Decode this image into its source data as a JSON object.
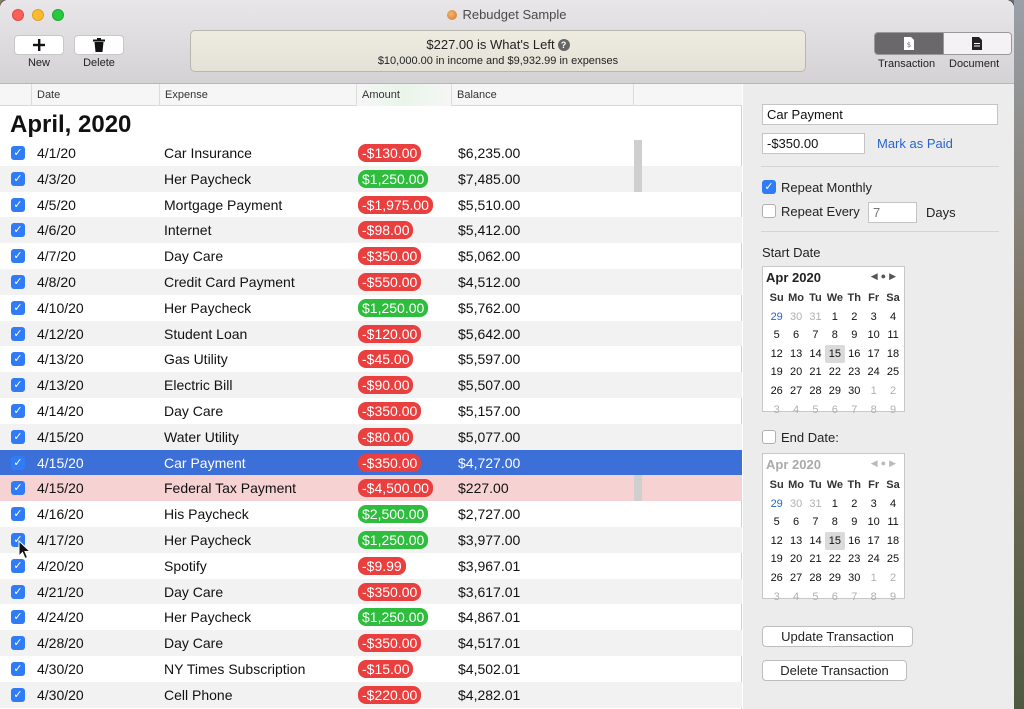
{
  "window": {
    "title": "Rebudget Sample"
  },
  "toolbar": {
    "new_label": "New",
    "delete_label": "Delete",
    "summary_line1": "$227.00 is What's Left",
    "summary_line2": "$10,000.00 in income and $9,932.99 in expenses",
    "transaction_label": "Transaction",
    "document_label": "Document"
  },
  "table": {
    "columns": [
      "Date",
      "Expense",
      "Amount",
      "Balance"
    ],
    "month": "April, 2020",
    "rows": [
      {
        "date": "4/1/20",
        "expense": "Car Insurance",
        "amount": "-$130.00",
        "balance": "$6,235.00",
        "kind": "neg"
      },
      {
        "date": "4/3/20",
        "expense": "Her Paycheck",
        "amount": "$1,250.00",
        "balance": "$7,485.00",
        "kind": "pos"
      },
      {
        "date": "4/5/20",
        "expense": "Mortgage Payment",
        "amount": "-$1,975.00",
        "balance": "$5,510.00",
        "kind": "neg"
      },
      {
        "date": "4/6/20",
        "expense": "Internet",
        "amount": "-$98.00",
        "balance": "$5,412.00",
        "kind": "neg"
      },
      {
        "date": "4/7/20",
        "expense": "Day Care",
        "amount": "-$350.00",
        "balance": "$5,062.00",
        "kind": "neg"
      },
      {
        "date": "4/8/20",
        "expense": "Credit Card Payment",
        "amount": "-$550.00",
        "balance": "$4,512.00",
        "kind": "neg"
      },
      {
        "date": "4/10/20",
        "expense": "Her Paycheck",
        "amount": "$1,250.00",
        "balance": "$5,762.00",
        "kind": "pos"
      },
      {
        "date": "4/12/20",
        "expense": "Student Loan",
        "amount": "-$120.00",
        "balance": "$5,642.00",
        "kind": "neg"
      },
      {
        "date": "4/13/20",
        "expense": "Gas Utility",
        "amount": "-$45.00",
        "balance": "$5,597.00",
        "kind": "neg"
      },
      {
        "date": "4/13/20",
        "expense": "Electric Bill",
        "amount": "-$90.00",
        "balance": "$5,507.00",
        "kind": "neg"
      },
      {
        "date": "4/14/20",
        "expense": "Day Care",
        "amount": "-$350.00",
        "balance": "$5,157.00",
        "kind": "neg"
      },
      {
        "date": "4/15/20",
        "expense": "Water Utility",
        "amount": "-$80.00",
        "balance": "$5,077.00",
        "kind": "neg"
      },
      {
        "date": "4/15/20",
        "expense": "Car Payment",
        "amount": "-$350.00",
        "balance": "$4,727.00",
        "kind": "neg"
      },
      {
        "date": "4/15/20",
        "expense": "Federal Tax Payment",
        "amount": "-$4,500.00",
        "balance": "$227.00",
        "kind": "neg"
      },
      {
        "date": "4/16/20",
        "expense": "His Paycheck",
        "amount": "$2,500.00",
        "balance": "$2,727.00",
        "kind": "pos"
      },
      {
        "date": "4/17/20",
        "expense": "Her Paycheck",
        "amount": "$1,250.00",
        "balance": "$3,977.00",
        "kind": "pos"
      },
      {
        "date": "4/20/20",
        "expense": "Spotify",
        "amount": "-$9.99",
        "balance": "$3,967.01",
        "kind": "neg"
      },
      {
        "date": "4/21/20",
        "expense": "Day Care",
        "amount": "-$350.00",
        "balance": "$3,617.01",
        "kind": "neg"
      },
      {
        "date": "4/24/20",
        "expense": "Her Paycheck",
        "amount": "$1,250.00",
        "balance": "$4,867.01",
        "kind": "pos"
      },
      {
        "date": "4/28/20",
        "expense": "Day Care",
        "amount": "-$350.00",
        "balance": "$4,517.01",
        "kind": "neg"
      },
      {
        "date": "4/30/20",
        "expense": "NY Times Subscription",
        "amount": "-$15.00",
        "balance": "$4,502.01",
        "kind": "neg"
      },
      {
        "date": "4/30/20",
        "expense": "Cell Phone",
        "amount": "-$220.00",
        "balance": "$4,282.01",
        "kind": "neg"
      }
    ]
  },
  "detail": {
    "name_value": "Car Payment",
    "amount_value": "-$350.00",
    "mark_paid_label": "Mark as Paid",
    "repeat_monthly_label": "Repeat Monthly",
    "repeat_every_label": "Repeat Every",
    "repeat_every_placeholder": "7",
    "days_label": "Days",
    "start_date_label": "Start Date",
    "end_date_label": "End Date:",
    "update_label": "Update Transaction",
    "delete_label": "Delete Transaction"
  },
  "calendar": {
    "month_label": "Apr 2020",
    "weekdays": [
      "Su",
      "Mo",
      "Tu",
      "We",
      "Th",
      "Fr",
      "Sa"
    ],
    "weeks": [
      [
        "29",
        "30",
        "31",
        "1",
        "2",
        "3",
        "4"
      ],
      [
        "5",
        "6",
        "7",
        "8",
        "9",
        "10",
        "11"
      ],
      [
        "12",
        "13",
        "14",
        "15",
        "16",
        "17",
        "18"
      ],
      [
        "19",
        "20",
        "21",
        "22",
        "23",
        "24",
        "25"
      ],
      [
        "26",
        "27",
        "28",
        "29",
        "30",
        "1",
        "2"
      ],
      [
        "3",
        "4",
        "5",
        "6",
        "7",
        "8",
        "9"
      ]
    ],
    "selected_day": "15"
  },
  "colors": {
    "negative": "#ea3f3f",
    "positive": "#2fbd3e",
    "selection": "#3d6fd8",
    "highlight_row": "#f7d2d2",
    "link": "#2865d0"
  },
  "selected_row_index": 12,
  "highlight_row_index": 13
}
